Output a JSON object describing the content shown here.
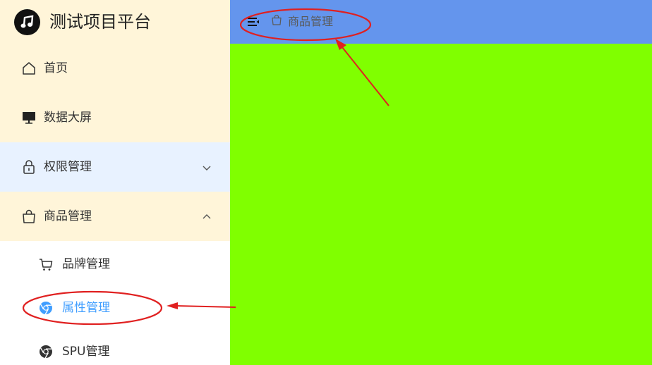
{
  "app": {
    "title": "测试项目平台"
  },
  "sidebar": {
    "items": [
      {
        "label": "首页",
        "icon": "home-icon"
      },
      {
        "label": "数据大屏",
        "icon": "monitor-icon"
      },
      {
        "label": "权限管理",
        "icon": "lock-icon",
        "expanded": false
      },
      {
        "label": "商品管理",
        "icon": "shopping-bag-icon",
        "expanded": true,
        "children": [
          {
            "label": "品牌管理",
            "icon": "cart-icon"
          },
          {
            "label": "属性管理",
            "icon": "chrome-icon",
            "active": true
          },
          {
            "label": "SPU管理",
            "icon": "chrome-icon"
          }
        ]
      }
    ]
  },
  "header": {
    "breadcrumb": "商品管理",
    "breadcrumb_icon": "shopping-bag-icon",
    "fold_icon": "fold-menu-icon"
  },
  "colors": {
    "sidebar_bg": "#fff5d9",
    "header_bg": "#6495ed",
    "main_bg": "#80ff00",
    "active_text": "#409eff",
    "hover_bg": "#e8f2ff",
    "annotation": "#e02020"
  }
}
